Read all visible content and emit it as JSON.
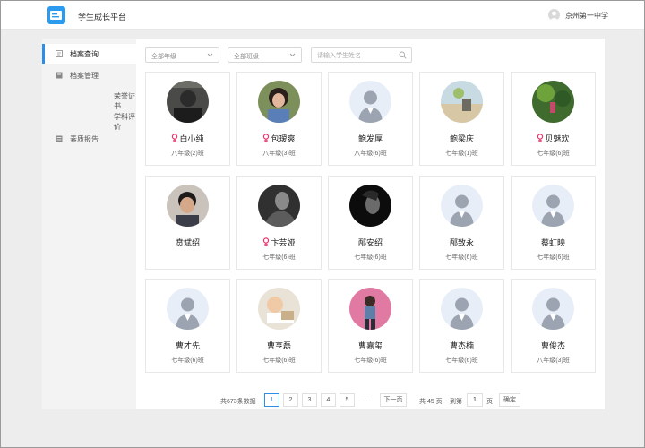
{
  "app": {
    "title": "学生成长平台",
    "school": "京州第一中学"
  },
  "sidebar": {
    "items": [
      {
        "label": "档案查询"
      },
      {
        "label": "档案管理"
      },
      {
        "label": "荣誉证书"
      },
      {
        "label": "学科评价"
      },
      {
        "label": "素质报告"
      }
    ]
  },
  "filters": {
    "grade": "全部年级",
    "class": "全部班级",
    "search_placeholder": "请输入学生姓名"
  },
  "students": [
    {
      "name": "白小纯",
      "cls": "八年级(2)班",
      "female": true,
      "avatar": "photo-dark"
    },
    {
      "name": "包瑷爽",
      "cls": "八年级(3)班",
      "female": true,
      "avatar": "photo-girl"
    },
    {
      "name": "鲍发厚",
      "cls": "八年级(6)班",
      "female": false,
      "avatar": "default"
    },
    {
      "name": "鲍梁庆",
      "cls": "七年级(1)班",
      "female": false,
      "avatar": "photo-beach"
    },
    {
      "name": "贝魅欢",
      "cls": "七年级(6)班",
      "female": true,
      "avatar": "photo-green"
    },
    {
      "name": "贲斌绍",
      "cls": "",
      "female": false,
      "avatar": "photo-boy"
    },
    {
      "name": "卞芸娅",
      "cls": "七年级(6)班",
      "female": true,
      "avatar": "photo-bw"
    },
    {
      "name": "邴安绍",
      "cls": "七年级(6)班",
      "female": false,
      "avatar": "photo-black"
    },
    {
      "name": "邴致永",
      "cls": "七年级(6)班",
      "female": false,
      "avatar": "default"
    },
    {
      "name": "蔡虹映",
      "cls": "七年级(6)班",
      "female": false,
      "avatar": "default"
    },
    {
      "name": "曹才先",
      "cls": "七年级(6)班",
      "female": false,
      "avatar": "default"
    },
    {
      "name": "曹亨磊",
      "cls": "七年级(6)班",
      "female": false,
      "avatar": "photo-baby"
    },
    {
      "name": "曹嘉玺",
      "cls": "七年级(6)班",
      "female": false,
      "avatar": "photo-pink"
    },
    {
      "name": "曹杰楠",
      "cls": "七年级(6)班",
      "female": false,
      "avatar": "default"
    },
    {
      "name": "曹俊杰",
      "cls": "八年级(3)班",
      "female": false,
      "avatar": "default"
    }
  ],
  "pagination": {
    "total": "共673条数据",
    "pages": [
      "1",
      "2",
      "3",
      "4",
      "5"
    ],
    "ellipsis": "...",
    "next": "下一页",
    "page_count_text": "共 45 页,",
    "goto_text": "到第",
    "goto_value": "1",
    "page_suffix": "页",
    "confirm": "确定"
  },
  "colors": {
    "accent": "#2b8fe8",
    "female": "#e8336b",
    "logo": "#2b9bf0"
  }
}
